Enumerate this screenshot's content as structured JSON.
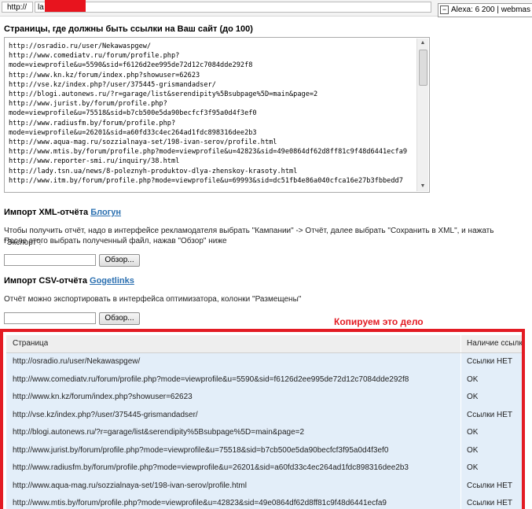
{
  "browser": {
    "protocol": "http://",
    "url_partial": "la",
    "alexa_text": "Alexa: 6 200 | webmas"
  },
  "links_section": {
    "title": "Страницы, где должны быть ссылки на Ваш сайт (до 100)",
    "text": "http://osradio.ru/user/Nekawaspgew/\nhttp://www.comediatv.ru/forum/profile.php?\nmode=viewprofile&u=5590&sid=f6126d2ee995de72d12c7084dde292f8\nhttp://www.kn.kz/forum/index.php?showuser=62623\nhttp://vse.kz/index.php?/user/375445-grismandadser/\nhttp://blogi.autonews.ru/?r=garage/list&serendipity%5Bsubpage%5D=main&page=2\nhttp://www.jurist.by/forum/profile.php?\nmode=viewprofile&u=75518&sid=b7cb500e5da90becfcf3f95a0d4f3ef0\nhttp://www.radiusfm.by/forum/profile.php?\nmode=viewprofile&u=26201&sid=a60fd33c4ec264ad1fdc898316dee2b3\nhttp://www.aqua-mag.ru/sozzialnaya-set/198-ivan-serov/profile.html\nhttp://www.mtis.by/forum/profile.php?mode=viewprofile&u=42823&sid=49e0864df62d8ff81c9f48d6441ecfa9\nhttp://www.reporter-smi.ru/inquiry/38.html\nhttp://lady.tsn.ua/news/8-poleznyh-produktov-dlya-zhenskoy-krasoty.html\nhttp://www.itm.by/forum/profile.php?mode=viewprofile&u=69993&sid=dc51fb4e86a040cfca16e27b3fbbedd7"
  },
  "xml_import": {
    "title": "Импорт XML-отчёта",
    "link": "Блогун",
    "desc_line1": "Чтобы получить отчёт, надо в интерфейсе рекламодателя выбрать \"Кампании\" -> Отчёт, далее выбрать \"Сохранить в XML\", и нажать \"Экспорт\".",
    "desc_line2": "После этого выбрать полученный файл, нажав \"Обзор\" ниже",
    "browse_label": "Обзор..."
  },
  "csv_import": {
    "title": "Импорт CSV-отчёта",
    "link": "Gogetlinks",
    "desc": "Отчёт можно экспортировать в интерфейса оптимизатора, колонки \"Размещены\"",
    "browse_label": "Обзор..."
  },
  "annotation": "Копируем это дело",
  "results_table": {
    "headers": [
      "Страница",
      "Наличие ссылки"
    ],
    "rows": [
      {
        "page": "http://osradio.ru/user/Nekawaspgew/",
        "status": "Ссылки НЕТ"
      },
      {
        "page": "http://www.comediatv.ru/forum/profile.php?mode=viewprofile&u=5590&sid=f6126d2ee995de72d12c7084dde292f8",
        "status": "OK"
      },
      {
        "page": "http://www.kn.kz/forum/index.php?showuser=62623",
        "status": "OK"
      },
      {
        "page": "http://vse.kz/index.php?/user/375445-grismandadser/",
        "status": "Ссылки НЕТ"
      },
      {
        "page": "http://blogi.autonews.ru/?r=garage/list&serendipity%5Bsubpage%5D=main&page=2",
        "status": "OK"
      },
      {
        "page": "http://www.jurist.by/forum/profile.php?mode=viewprofile&u=75518&sid=b7cb500e5da90becfcf3f95a0d4f3ef0",
        "status": "OK"
      },
      {
        "page": "http://www.radiusfm.by/forum/profile.php?mode=viewprofile&u=26201&sid=a60fd33c4ec264ad1fdc898316dee2b3",
        "status": "OK"
      },
      {
        "page": "http://www.aqua-mag.ru/sozzialnaya-set/198-ivan-serov/profile.html",
        "status": "Ссылки НЕТ"
      },
      {
        "page": "http://www.mtis.by/forum/profile.php?mode=viewprofile&u=42823&sid=49e0864df62d8ff81c9f48d6441ecfa9",
        "status": "Ссылки НЕТ"
      }
    ]
  }
}
